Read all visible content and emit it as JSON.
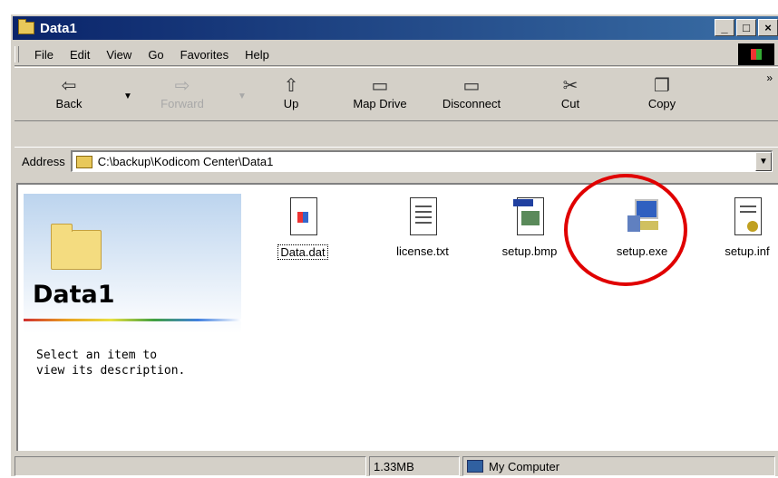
{
  "window": {
    "title": "Data1"
  },
  "title_buttons": [
    "_",
    "□",
    "×"
  ],
  "menu": [
    "File",
    "Edit",
    "View",
    "Go",
    "Favorites",
    "Help"
  ],
  "toolbar": {
    "back": "Back",
    "forward": "Forward",
    "up": "Up",
    "map_drive": "Map Drive",
    "disconnect": "Disconnect",
    "cut": "Cut",
    "copy": "Copy",
    "more": "»"
  },
  "address": {
    "label": "Address",
    "value": "C:\\backup\\Kodicom Center\\Data1"
  },
  "panel": {
    "title": "Data1",
    "description": "Select an item to view its description."
  },
  "files": [
    {
      "name": "Data.dat",
      "icon": "dat-file-icon",
      "selected": true
    },
    {
      "name": "license.txt",
      "icon": "text-file-icon",
      "selected": false
    },
    {
      "name": "setup.bmp",
      "icon": "bitmap-file-icon",
      "selected": false
    },
    {
      "name": "setup.exe",
      "icon": "setup-exe-icon",
      "selected": false
    },
    {
      "name": "setup.inf",
      "icon": "inf-file-icon",
      "selected": false
    }
  ],
  "status": {
    "size": "1.33MB",
    "location": "My Computer"
  },
  "colors": {
    "highlight_circle": "#e00000",
    "title_bar": "#0a246a"
  }
}
